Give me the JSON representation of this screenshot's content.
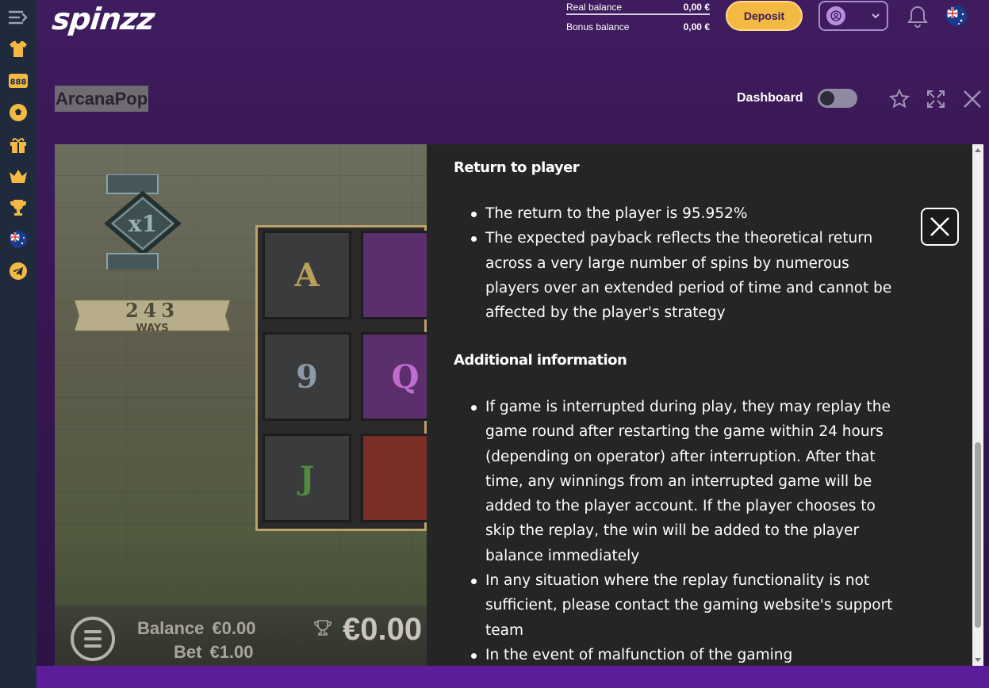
{
  "brand": {
    "logo_text": "spinzz"
  },
  "header": {
    "real_balance_label": "Real balance",
    "real_balance_value": "0,00 €",
    "bonus_balance_label": "Bonus balance",
    "bonus_balance_value": "0,00 €",
    "deposit_label": "Deposit"
  },
  "sidebar": {
    "items": [
      {
        "icon": "menu-toggle-icon"
      },
      {
        "icon": "jersey-icon"
      },
      {
        "icon": "lottery-888-icon",
        "label": "888"
      },
      {
        "icon": "soccer-ball-icon"
      },
      {
        "icon": "gift-icon"
      },
      {
        "icon": "crown-icon"
      },
      {
        "icon": "trophy-icon"
      },
      {
        "icon": "australia-flag-icon"
      },
      {
        "icon": "telegram-icon"
      }
    ]
  },
  "game_bar": {
    "title": "ArcanaPop",
    "dashboard_label": "Dashboard",
    "dashboard_toggle_on": false
  },
  "game": {
    "multiplier": "x1",
    "ways_count": "243",
    "ways_label": "WAYS",
    "reel_symbols": [
      "A",
      "9",
      "J",
      "",
      "Q",
      ""
    ],
    "balance_label": "Balance",
    "balance_value": "€0.00",
    "bet_label": "Bet",
    "bet_value": "€1.00",
    "win_value": "€0.00"
  },
  "info_panel": {
    "section1_title": "Return to player",
    "section1_items": [
      "The return to the player is 95.952%",
      "The expected payback reflects the theoretical return across a very large number of spins by numerous players over an extended period of time and cannot be affected by the player's strategy"
    ],
    "section2_title": "Additional information",
    "section2_items": [
      "If game is interrupted during play, they may replay the game round after restarting the game within 24 hours (depending on operator) after interruption. After that time, any winnings from an interrupted game will be added to the player account. If the player chooses to skip the replay, the win will be added to the player balance immediately",
      "In any situation where the replay functionality is not sufficient, please contact the gaming website's support team",
      "In the event of malfunction of the gaming"
    ]
  },
  "colors": {
    "accent_gold": "#f4b942",
    "purple_bg": "#3f1c5e",
    "sidebar_bg": "#1f2a3d",
    "info_bg": "#252525"
  }
}
